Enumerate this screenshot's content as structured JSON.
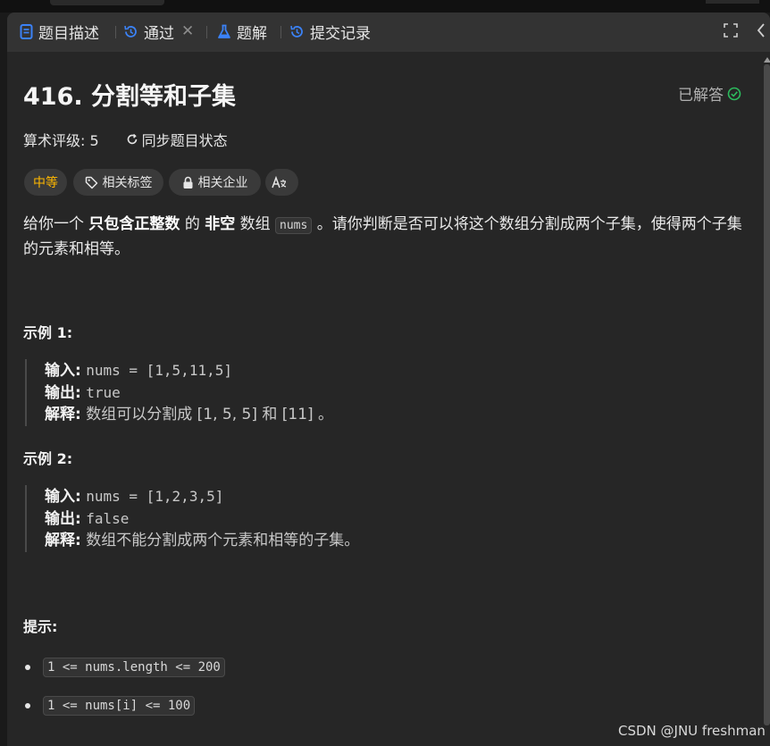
{
  "tabs": [
    {
      "label": "题目描述"
    },
    {
      "label": "通过",
      "close": "✕"
    },
    {
      "label": "题解"
    },
    {
      "label": "提交记录"
    }
  ],
  "problem": {
    "title": "416. 分割等和子集",
    "status": "已解答",
    "rating": "算术评级: 5",
    "sync": "同步题目状态",
    "tags": {
      "difficulty": "中等",
      "related_tags": "相关标签",
      "related_companies": "相关企业"
    },
    "desc": {
      "p1": "给你一个",
      "b1": "只包含正整数",
      "p2": "的",
      "b2": "非空",
      "p3": "数组",
      "code": "nums",
      "p4": "。请你判断是否可以将这个数组分割成两个子集，使得两个子集的元素和相等。"
    }
  },
  "examples": [
    {
      "heading": "示例 1:",
      "input_label": "输入:",
      "input": "nums = [1,5,11,5]",
      "output_label": "输出:",
      "output": "true",
      "explain_label": "解释:",
      "explain": "数组可以分割成 [1, 5, 5] 和 [11] 。"
    },
    {
      "heading": "示例 2:",
      "input_label": "输入:",
      "input": "nums = [1,2,3,5]",
      "output_label": "输出:",
      "output": "false",
      "explain_label": "解释:",
      "explain": "数组不能分割成两个元素和相等的子集。"
    }
  ],
  "constraints": {
    "heading": "提示:",
    "items": [
      "1 <= nums.length <= 200",
      "1 <= nums[i] <= 100"
    ]
  },
  "watermark": "CSDN @JNU freshman",
  "colors": {
    "accent": "#3b82f6",
    "difficulty": "#ffb800",
    "solved": "#2cbb5d"
  }
}
